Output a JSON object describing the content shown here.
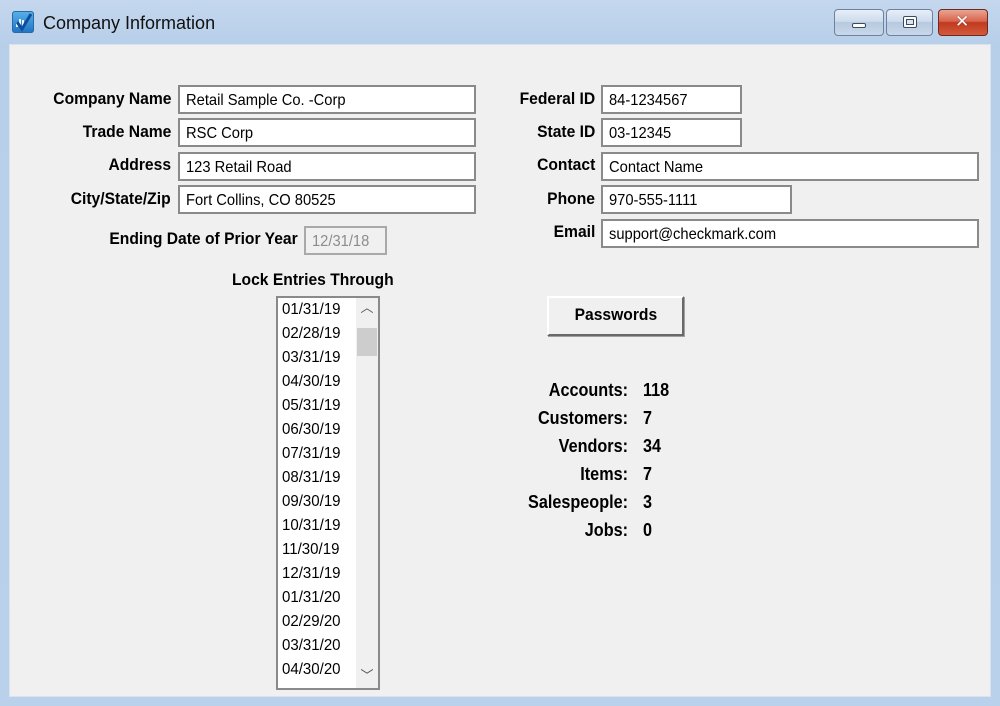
{
  "window": {
    "title": "Company Information",
    "controls": {
      "minimize": "minimize",
      "maximize": "maximize",
      "close": "✕"
    }
  },
  "form": {
    "company_name": {
      "label": "Company Name",
      "value": "Retail Sample Co. -Corp"
    },
    "trade_name": {
      "label": "Trade Name",
      "value": "RSC Corp"
    },
    "address": {
      "label": "Address",
      "value": "123 Retail Road"
    },
    "city_state_zip": {
      "label": "City/State/Zip",
      "value": "Fort Collins, CO  80525"
    },
    "ending_date_prior_year": {
      "label": "Ending Date of Prior Year",
      "value": "12/31/18"
    },
    "federal_id": {
      "label": "Federal ID",
      "value": "84-1234567"
    },
    "state_id": {
      "label": "State ID",
      "value": "03-12345"
    },
    "contact": {
      "label": "Contact",
      "value": "Contact Name"
    },
    "phone": {
      "label": "Phone",
      "value": "970-555-1111"
    },
    "email": {
      "label": "Email",
      "value": "support@checkmark.com"
    }
  },
  "lock_entries": {
    "label": "Lock Entries Through",
    "items": [
      "01/31/19",
      "02/28/19",
      "03/31/19",
      "04/30/19",
      "05/31/19",
      "06/30/19",
      "07/31/19",
      "08/31/19",
      "09/30/19",
      "10/31/19",
      "11/30/19",
      "12/31/19",
      "01/31/20",
      "02/29/20",
      "03/31/20",
      "04/30/20"
    ]
  },
  "passwords_button": "Passwords",
  "stats": [
    {
      "label": "Accounts:",
      "value": "118"
    },
    {
      "label": "Customers:",
      "value": "7"
    },
    {
      "label": "Vendors:",
      "value": "34"
    },
    {
      "label": "Items:",
      "value": "7"
    },
    {
      "label": "Salespeople:",
      "value": "3"
    },
    {
      "label": "Jobs:",
      "value": "0"
    }
  ]
}
